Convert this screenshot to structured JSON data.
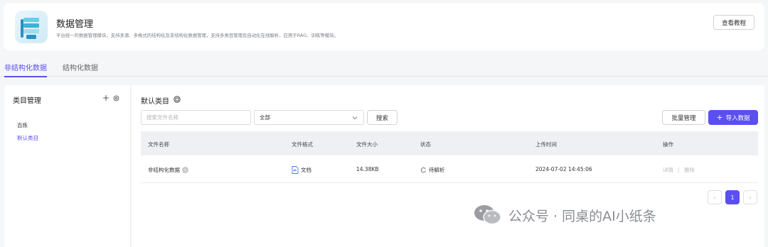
{
  "header": {
    "title": "数据管理",
    "description": "平台统一的数据管理模块，支持多源、多格式的结构化及非结构化数据管理，支持多类目管理及自动化在线解析，应用于RAG、训练等模块。",
    "tutorial_label": "查看教程"
  },
  "tabs": [
    {
      "label": "非结构化数据",
      "active": true
    },
    {
      "label": "结构化数据",
      "active": false
    }
  ],
  "sidebar": {
    "title": "类目管理",
    "items": [
      {
        "label": "百炼"
      },
      {
        "label": "默认类目",
        "active": true
      }
    ]
  },
  "main": {
    "category_title": "默认类目",
    "search": {
      "placeholder": "搜索文件名称",
      "button": "搜索"
    },
    "filter": {
      "value": "全部"
    },
    "batch_label": "批量管理",
    "import_label": "导入数据",
    "table": {
      "columns": [
        "文件名称",
        "文件格式",
        "文件大小",
        "状态",
        "上传时间",
        "操作"
      ],
      "rows": [
        {
          "name": "非结构化数据",
          "format": "文档",
          "size": "14.38KB",
          "status": "待解析",
          "uploaded": "2024-07-02 14:45:06",
          "actions": [
            "详情",
            "删除"
          ]
        }
      ]
    },
    "pagination": {
      "current": "1",
      "prev": "‹",
      "next": "›"
    }
  },
  "watermark": {
    "text": "公众号 · 同桌的AI小纸条"
  },
  "colors": {
    "accent": "#5b4ff0",
    "background": "#f5f6f8"
  }
}
